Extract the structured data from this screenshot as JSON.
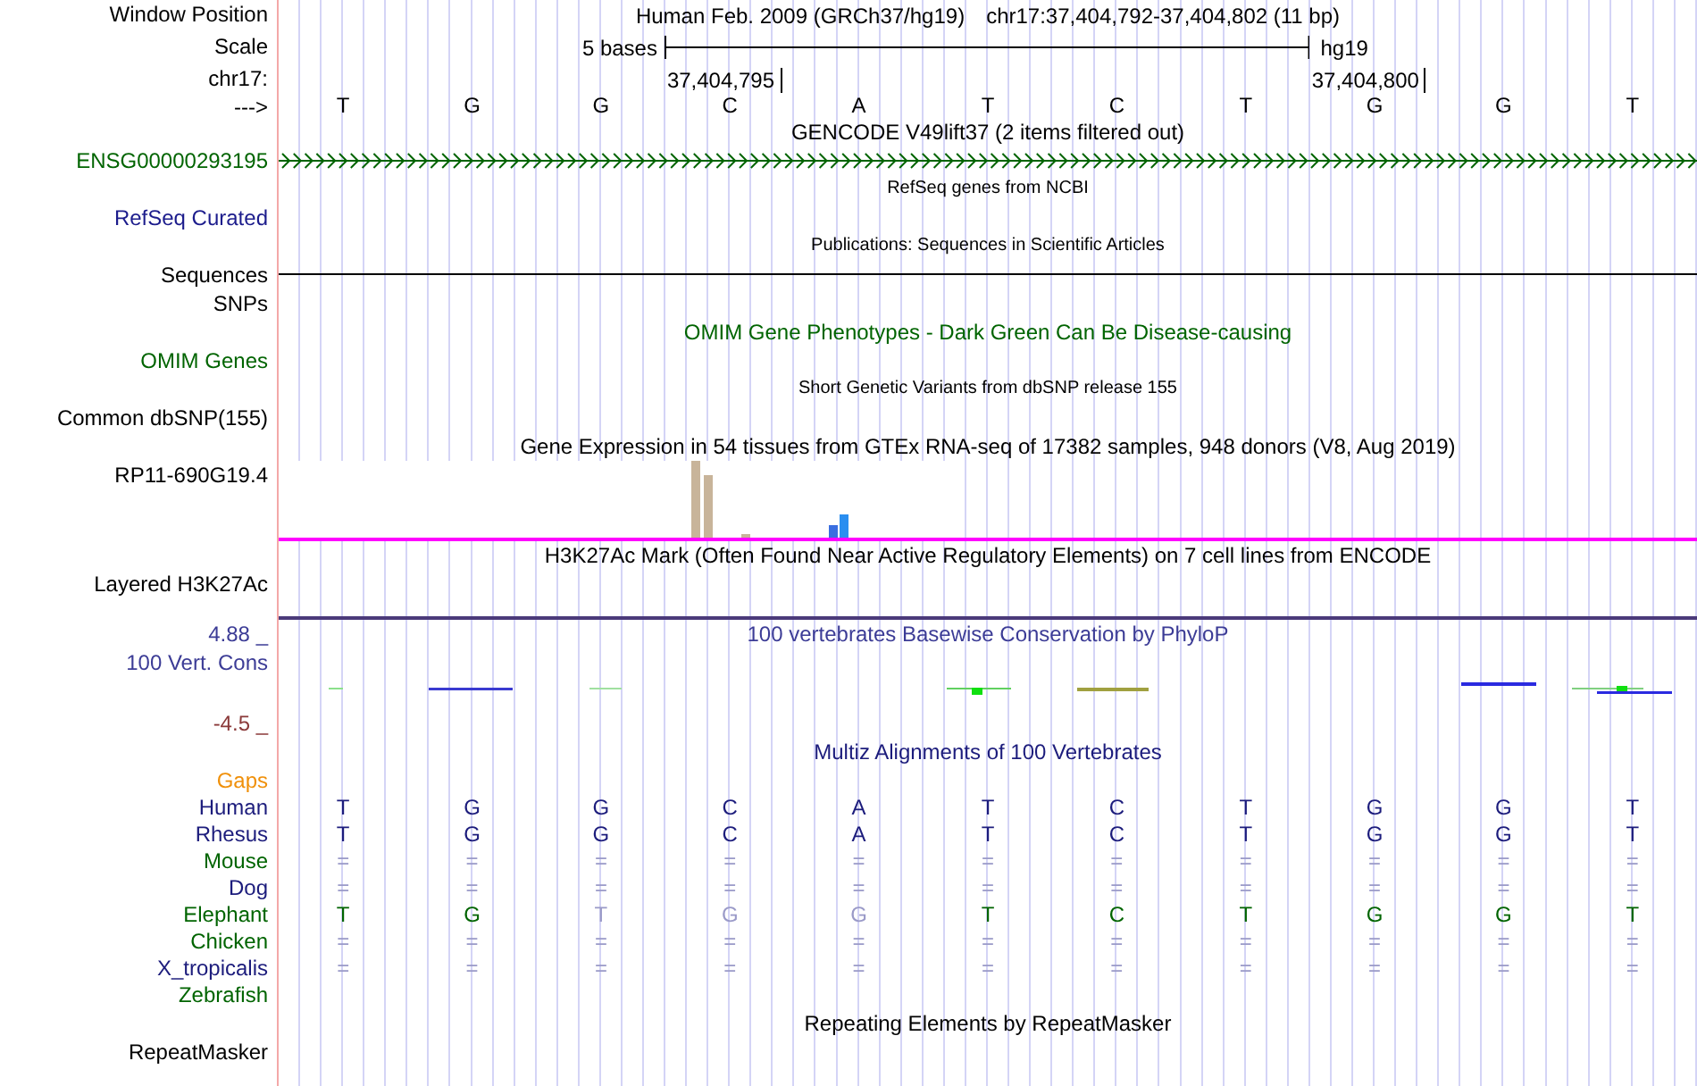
{
  "rows": [
    {
      "kind": "position",
      "label": "Window Position",
      "assembly": "Human Feb. 2009 (GRCh37/hg19)",
      "range": "chr17:37,404,792-37,404,802 (11 bp)"
    },
    {
      "kind": "scale",
      "label": "Scale",
      "length": "5 bases",
      "assembly": "hg19"
    },
    {
      "kind": "coordinates",
      "label": "chr17:",
      "ticks": [
        "37,404,795",
        "37,404,800"
      ]
    },
    {
      "kind": "bases",
      "label": "--->",
      "bases": [
        "T",
        "G",
        "G",
        "C",
        "A",
        "T",
        "C",
        "T",
        "G",
        "G",
        "T"
      ]
    },
    {
      "kind": "text",
      "title": "GENCODE V49lift37 (2 items filtered out)"
    },
    {
      "kind": "gene",
      "label": "ENSG00000293195",
      "color": "#006400"
    },
    {
      "kind": "note",
      "title": "RefSeq genes from NCBI"
    },
    {
      "kind": "text",
      "label": "RefSeq Curated",
      "color": "#1c1c8c"
    },
    {
      "kind": "note",
      "title": "Publications: Sequences in Scientific Articles"
    },
    {
      "kind": "rule",
      "label": "Sequences"
    },
    {
      "kind": "text",
      "label": "SNPs"
    },
    {
      "kind": "text",
      "title": "OMIM Gene Phenotypes - Dark Green Can Be Disease-causing",
      "color": "#006400"
    },
    {
      "kind": "text",
      "label": "OMIM Genes",
      "color": "#006400"
    },
    {
      "kind": "note",
      "title": "Short Genetic Variants from dbSNP release 155"
    },
    {
      "kind": "text",
      "label": "Common dbSNP(155)"
    },
    {
      "kind": "text",
      "title": "Gene Expression in 54 tissues from GTEx RNA-seq of 17382 samples, 948 donors (V8, Aug 2019)"
    },
    {
      "kind": "expression",
      "label": "RP11-690G19.4"
    },
    {
      "kind": "text",
      "title": "H3K27Ac Mark (Often Found Near Active Regulatory Elements) on 7 cell lines from ENCODE"
    },
    {
      "kind": "layered",
      "label": "Layered H3K27Ac"
    },
    {
      "kind": "text",
      "label": "4.88 _",
      "title": "100 vertebrates Basewise Conservation by PhyloP",
      "color": "#3c3c96"
    },
    {
      "kind": "conservation",
      "label": "100 Vert. Cons",
      "color": "#3c3c96"
    },
    {
      "kind": "text",
      "label": "-4.5 _",
      "color": "#8b3a3a"
    },
    {
      "kind": "text",
      "title": "Multiz Alignments of 100 Vertebrates",
      "color": "#1c1c7c"
    },
    {
      "kind": "text",
      "label": "Gaps",
      "color": "#f0900a"
    },
    {
      "kind": "alignment",
      "label": "Human",
      "color": "#1c1c7c",
      "bases": [
        {
          "text": "T",
          "faded": false
        },
        {
          "text": "G",
          "faded": false
        },
        {
          "text": "G",
          "faded": false
        },
        {
          "text": "C",
          "faded": false
        },
        {
          "text": "A",
          "faded": false
        },
        {
          "text": "T",
          "faded": false
        },
        {
          "text": "C",
          "faded": false
        },
        {
          "text": "T",
          "faded": false
        },
        {
          "text": "G",
          "faded": false
        },
        {
          "text": "G",
          "faded": false
        },
        {
          "text": "T",
          "faded": false
        }
      ]
    },
    {
      "kind": "alignment",
      "label": "Rhesus",
      "color": "#1c1c7c",
      "bases": [
        {
          "text": "T",
          "faded": false
        },
        {
          "text": "G",
          "faded": false
        },
        {
          "text": "G",
          "faded": false
        },
        {
          "text": "C",
          "faded": false
        },
        {
          "text": "A",
          "faded": false
        },
        {
          "text": "T",
          "faded": false
        },
        {
          "text": "C",
          "faded": false
        },
        {
          "text": "T",
          "faded": false
        },
        {
          "text": "G",
          "faded": false
        },
        {
          "text": "G",
          "faded": false
        },
        {
          "text": "T",
          "faded": false
        }
      ]
    },
    {
      "kind": "alignment",
      "label": "Mouse",
      "color": "#006400",
      "bases": [
        {
          "text": "=",
          "faded": true
        },
        {
          "text": "=",
          "faded": true
        },
        {
          "text": "=",
          "faded": true
        },
        {
          "text": "=",
          "faded": true
        },
        {
          "text": "=",
          "faded": true
        },
        {
          "text": "=",
          "faded": true
        },
        {
          "text": "=",
          "faded": true
        },
        {
          "text": "=",
          "faded": true
        },
        {
          "text": "=",
          "faded": true
        },
        {
          "text": "=",
          "faded": true
        },
        {
          "text": "=",
          "faded": true
        }
      ]
    },
    {
      "kind": "alignment",
      "label": "Dog",
      "color": "#1c1c7c",
      "bases": [
        {
          "text": "=",
          "faded": true
        },
        {
          "text": "=",
          "faded": true
        },
        {
          "text": "=",
          "faded": true
        },
        {
          "text": "=",
          "faded": true
        },
        {
          "text": "=",
          "faded": true
        },
        {
          "text": "=",
          "faded": true
        },
        {
          "text": "=",
          "faded": true
        },
        {
          "text": "=",
          "faded": true
        },
        {
          "text": "=",
          "faded": true
        },
        {
          "text": "=",
          "faded": true
        },
        {
          "text": "=",
          "faded": true
        }
      ]
    },
    {
      "kind": "alignment",
      "label": "Elephant",
      "color": "#006400",
      "bases": [
        {
          "text": "T",
          "faded": false
        },
        {
          "text": "G",
          "faded": false
        },
        {
          "text": "T",
          "faded": true
        },
        {
          "text": "G",
          "faded": true
        },
        {
          "text": "G",
          "faded": true
        },
        {
          "text": "T",
          "faded": false
        },
        {
          "text": "C",
          "faded": false
        },
        {
          "text": "T",
          "faded": false
        },
        {
          "text": "G",
          "faded": false
        },
        {
          "text": "G",
          "faded": false
        },
        {
          "text": "T",
          "faded": false
        }
      ]
    },
    {
      "kind": "alignment",
      "label": "Chicken",
      "color": "#006400",
      "bases": [
        {
          "text": "=",
          "faded": true
        },
        {
          "text": "=",
          "faded": true
        },
        {
          "text": "=",
          "faded": true
        },
        {
          "text": "=",
          "faded": true
        },
        {
          "text": "=",
          "faded": true
        },
        {
          "text": "=",
          "faded": true
        },
        {
          "text": "=",
          "faded": true
        },
        {
          "text": "=",
          "faded": true
        },
        {
          "text": "=",
          "faded": true
        },
        {
          "text": "=",
          "faded": true
        },
        {
          "text": "=",
          "faded": true
        }
      ]
    },
    {
      "kind": "alignment",
      "label": "X_tropicalis",
      "color": "#1c1c7c",
      "bases": [
        {
          "text": "=",
          "faded": true
        },
        {
          "text": "=",
          "faded": true
        },
        {
          "text": "=",
          "faded": true
        },
        {
          "text": "=",
          "faded": true
        },
        {
          "text": "=",
          "faded": true
        },
        {
          "text": "=",
          "faded": true
        },
        {
          "text": "=",
          "faded": true
        },
        {
          "text": "=",
          "faded": true
        },
        {
          "text": "=",
          "faded": true
        },
        {
          "text": "=",
          "faded": true
        },
        {
          "text": "=",
          "faded": true
        }
      ]
    },
    {
      "kind": "alignment",
      "label": "Zebrafish",
      "color": "#006400"
    },
    {
      "kind": "text",
      "title": "Repeating Elements by RepeatMasker"
    },
    {
      "kind": "text",
      "label": "RepeatMasker"
    }
  ]
}
